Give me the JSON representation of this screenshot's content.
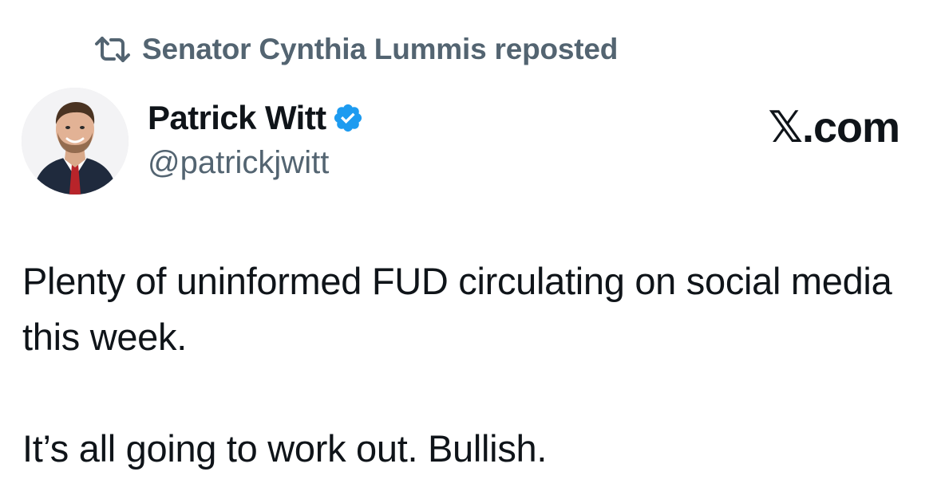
{
  "repost": {
    "text": "Senator Cynthia Lummis reposted",
    "icon": "repost-icon"
  },
  "author": {
    "display_name": "Patrick Witt",
    "handle": "@patrickjwitt",
    "verified": true,
    "verified_color": "#1d9bf0",
    "avatar": "avatar-photo"
  },
  "brand": {
    "label": "𝕏.com"
  },
  "tweet": {
    "paragraph_1": "Plenty of uninformed FUD circulating on social media this week.",
    "paragraph_2": "It’s all going to work out. Bullish."
  },
  "colors": {
    "text_primary": "#0f1419",
    "text_secondary": "#536471",
    "accent": "#1d9bf0"
  }
}
